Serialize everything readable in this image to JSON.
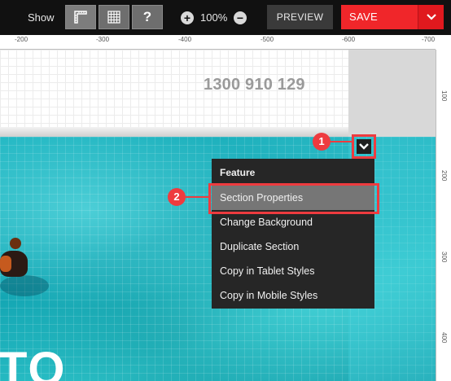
{
  "toolbar": {
    "show_label": "Show",
    "help_label": "?",
    "zoom_in_label": "+",
    "zoom_level": "100%",
    "zoom_out_label": "−",
    "preview_label": "PREVIEW",
    "save_label": "SAVE"
  },
  "ruler": {
    "top_ticks": [
      "-200",
      "-300",
      "-400",
      "-500",
      "-600",
      "-700"
    ],
    "right_ticks": [
      "100",
      "200",
      "300",
      "400"
    ]
  },
  "canvas": {
    "phone": "1300 910 129",
    "hero_text": "TO"
  },
  "callouts": {
    "step1": "1",
    "step2": "2"
  },
  "menu": {
    "title": "Feature",
    "items": [
      {
        "label": "Section Properties"
      },
      {
        "label": "Change Background"
      },
      {
        "label": "Duplicate Section"
      },
      {
        "label": "Copy in Tablet Styles"
      },
      {
        "label": "Copy in Mobile Styles"
      }
    ]
  },
  "colors": {
    "accent_red": "#ee3b3f",
    "save_red": "#f0262a",
    "menu_bg": "#262626",
    "water": "#1fb5c1"
  },
  "icons": [
    "ruler-icon",
    "grid-icon",
    "help-icon",
    "zoom-in-icon",
    "zoom-out-icon",
    "chevron-down-icon"
  ]
}
